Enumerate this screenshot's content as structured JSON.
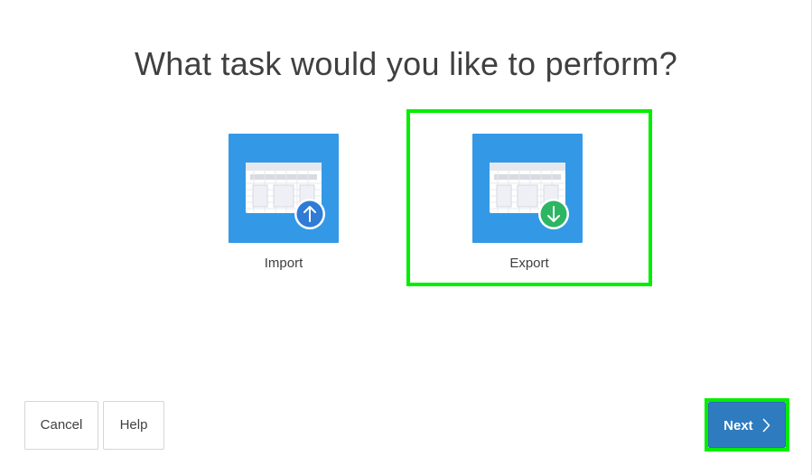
{
  "dialog": {
    "title": "What task would you like to perform?"
  },
  "tasks": [
    {
      "label": "Import",
      "icon": "table-upload-icon",
      "selected": false,
      "badge_color": "#2f7bd6"
    },
    {
      "label": "Export",
      "icon": "table-download-icon",
      "selected": true,
      "badge_color": "#2db563"
    }
  ],
  "footer": {
    "cancel_label": "Cancel",
    "help_label": "Help",
    "next_label": "Next",
    "next_icon": "chevron-right-icon"
  },
  "colors": {
    "tile": "#3399e6",
    "highlight": "#00ee00",
    "next_button": "#2f7bbf"
  }
}
